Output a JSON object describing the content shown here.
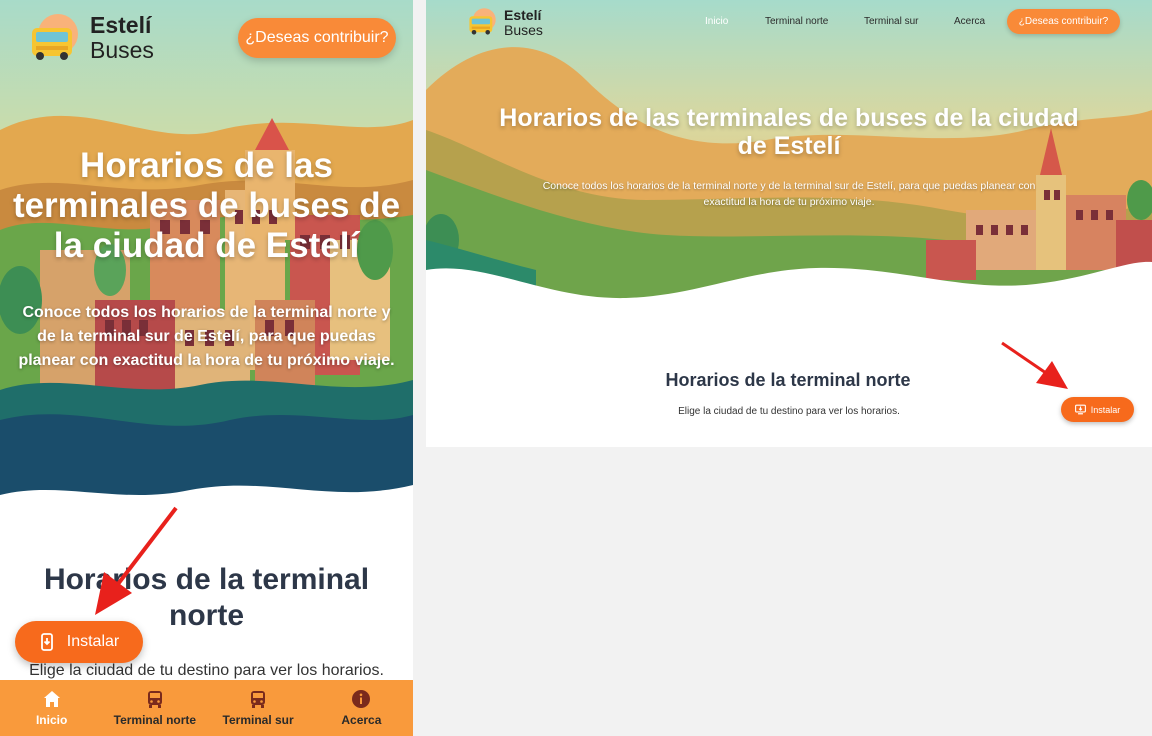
{
  "brand": {
    "line1": "Estelí",
    "line2": "Buses"
  },
  "contribute_label": "¿Deseas contribuir?",
  "hero": {
    "title": "Horarios de las terminales de buses de la ciudad de Estelí",
    "description": "Conoce todos los horarios de la terminal norte y de la terminal sur de Estelí, para que puedas planear con exactitud la hora de tu próximo viaje."
  },
  "section": {
    "title": "Horarios de la terminal norte",
    "subtitle": "Elige la ciudad de tu destino para ver los horarios."
  },
  "install_label": "Instalar",
  "nav": [
    {
      "label": "Inicio",
      "icon": "home-icon",
      "active": true
    },
    {
      "label": "Terminal norte",
      "icon": "bus-icon",
      "active": false
    },
    {
      "label": "Terminal sur",
      "icon": "bus-icon",
      "active": false
    },
    {
      "label": "Acerca",
      "icon": "info-icon",
      "active": false
    }
  ],
  "colors": {
    "accent": "#f98a38",
    "install": "#f76a1c",
    "nav_bg": "#f99a3c",
    "heading": "#2d3748",
    "arrow": "#e8211c"
  }
}
